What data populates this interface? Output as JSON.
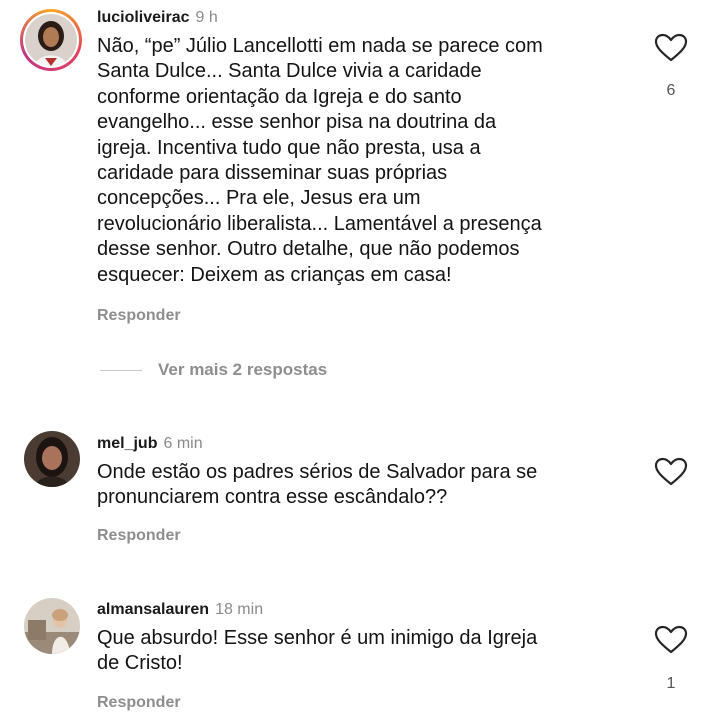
{
  "comments": [
    {
      "username": "lucioliveirac",
      "time": "9 h",
      "text": "Não, “pe” Júlio Lancellotti em nada se parece com\nSanta Dulce... Santa Dulce vivia a caridade\nconforme orientação da Igreja e do santo\nevangelho... esse senhor pisa na doutrina da\nigreja. Incentiva tudo que não presta, usa a\ncaridade para disseminar suas próprias\nconcepções... Pra ele, Jesus era um\nrevolucionário liberalista... Lamentável a presença\ndesse senhor. Outro detalhe, que não podemos\nesquecer: Deixem as crianças em casa!",
      "reply_label": "Responder",
      "likes": "6"
    },
    {
      "username": "mel_jub",
      "time": "6 min",
      "text": "Onde estão os padres sérios de Salvador para se\npronunciarem contra esse escândalo??",
      "reply_label": "Responder",
      "likes": ""
    },
    {
      "username": "almansalauren",
      "time": "18 min",
      "text": "Que absurdo! Esse senhor é um inimigo da Igreja\nde Cristo!",
      "reply_label": "Responder",
      "likes": "1"
    }
  ],
  "more_replies_label": "Ver mais 2 respostas",
  "icons": {
    "like": "heart-outline-icon"
  },
  "colors": {
    "text": "#141414",
    "muted": "#8e8e8e",
    "story_ring": "#e4405f"
  }
}
